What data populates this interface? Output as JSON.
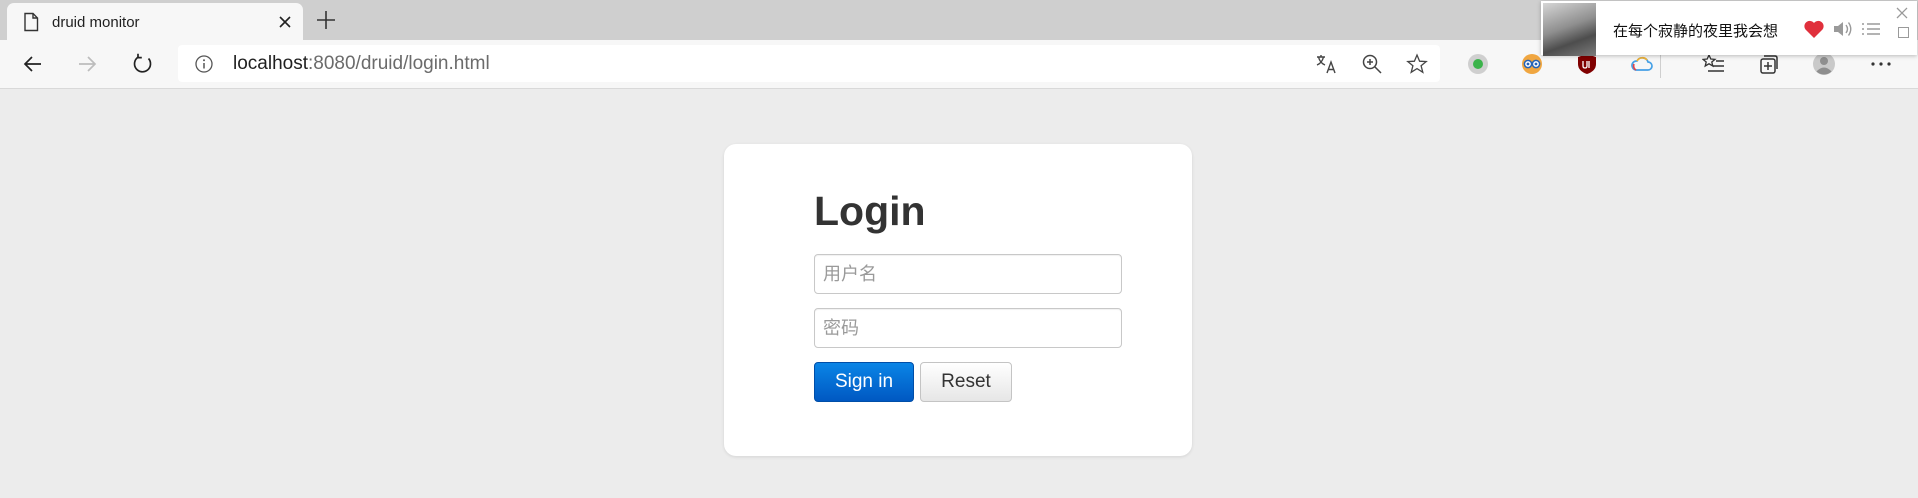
{
  "browser": {
    "tab": {
      "title": "druid monitor",
      "icon": "page-icon"
    },
    "address_bar": {
      "host": "localhost",
      "path": ":8080/druid/login.html"
    }
  },
  "media_popup": {
    "song_title": "在每个寂静的夜里我会想",
    "accent_color": "#e0303c"
  },
  "login": {
    "heading": "Login",
    "username": {
      "placeholder": "用户名",
      "value": ""
    },
    "password": {
      "placeholder": "密码",
      "value": ""
    },
    "signin_label": "Sign in",
    "reset_label": "Reset",
    "primary_color": "#0a6fd6"
  }
}
